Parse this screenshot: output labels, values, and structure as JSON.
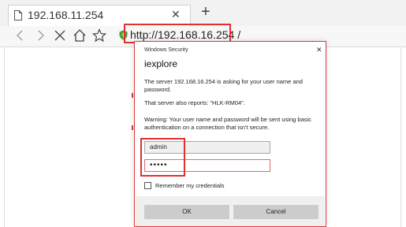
{
  "browser": {
    "tab": {
      "title": "192.168.11.254",
      "close_icon": "close-icon"
    },
    "new_tab_icon": "plus-icon",
    "nav": {
      "icons": [
        "back-icon",
        "forward-icon",
        "stop-icon",
        "home-icon",
        "favorite-icon"
      ],
      "address": "http://192.168.16.254 /"
    }
  },
  "dialog": {
    "window_title": "Windows Security",
    "app_name": "iexplore",
    "message": "The server 192.168.16.254 is asking for your user name and password.",
    "server_reports": "That server also reports: \"HLK-RM04\".",
    "warning": "Warning: Your user name and password will be sent using basic authentication on a connection that isn't secure.",
    "username": "admin",
    "password_mask": "•••••",
    "remember_label": "Remember my credentials",
    "remember_checked": false,
    "ok_label": "OK",
    "cancel_label": "Cancel"
  },
  "colors": {
    "highlight": "#e03030",
    "shield": "#4a9b3c"
  }
}
